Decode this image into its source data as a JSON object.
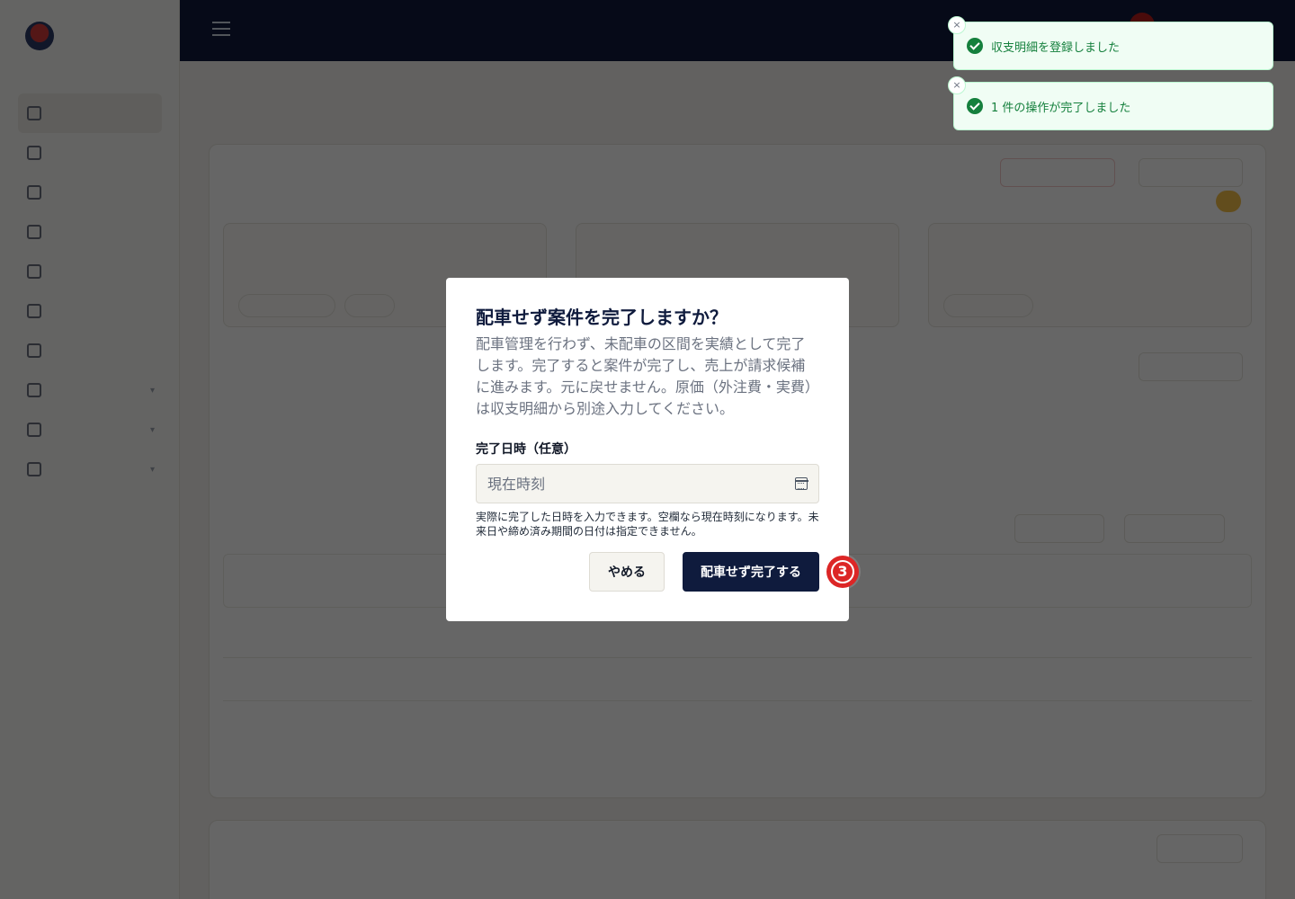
{
  "dialog": {
    "title": "配車せず案件を完了しますか？",
    "description": "配車管理を行わず、未配車の区間を実績として完了します。完了すると案件が完了し、売上が請求候補に進みます。元に戻せません。原価（外注費・実費）は収支明細から別途入力してください。",
    "field_label": "完了日時（任意）",
    "date_placeholder": "現在時刻",
    "hint": "実際に完了した日時を入力できます。空欄なら現在時刻になります。未来日や締め済み期間の日付は指定できません。",
    "cancel_label": "やめる",
    "confirm_label": "配車せず完了する"
  },
  "step_badge": {
    "label": "3"
  },
  "toasts": [
    {
      "text": "収支明細を登録しました",
      "close": "×"
    },
    {
      "text": "1 件の操作が完了しました",
      "close": "×"
    }
  ],
  "colors": {
    "primary": "#0f1b3d",
    "success": "#15803d",
    "danger": "#dc2626"
  }
}
